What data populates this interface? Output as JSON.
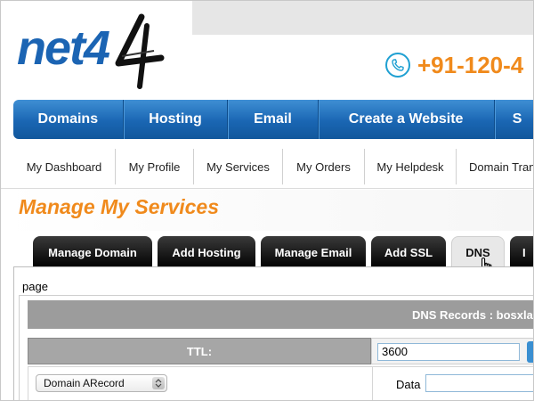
{
  "brand": {
    "logo_text": "net4",
    "phone": "+91-120-4",
    "accent_orange": "#f08a1c",
    "brand_blue": "#1b64b3"
  },
  "main_nav": {
    "items": [
      {
        "label": "Domains"
      },
      {
        "label": "Hosting"
      },
      {
        "label": "Email"
      },
      {
        "label": "Create a Website"
      },
      {
        "label": "S"
      }
    ]
  },
  "sub_nav": {
    "items": [
      {
        "label": "My Dashboard"
      },
      {
        "label": "My Profile"
      },
      {
        "label": "My Services"
      },
      {
        "label": "My Orders"
      },
      {
        "label": "My Helpdesk"
      },
      {
        "label": "Domain Tran"
      }
    ]
  },
  "page": {
    "title": "Manage My Services",
    "page_label": "page"
  },
  "tabs": {
    "items": [
      {
        "label": "Manage Domain"
      },
      {
        "label": "Add Hosting"
      },
      {
        "label": "Manage Email"
      },
      {
        "label": "Add SSL"
      },
      {
        "label": "DNS",
        "active": true
      },
      {
        "label": "I"
      }
    ]
  },
  "dns": {
    "header": "DNS Records : bosxla",
    "ttl_label": "TTL:",
    "ttl_value": "3600",
    "record_type_selected": "Domain ARecord",
    "data_label": "Data",
    "data_value": ""
  },
  "icons": {
    "phone": "phone-icon",
    "cursor": "hand-pointer-icon",
    "select": "select-arrows-icon"
  }
}
